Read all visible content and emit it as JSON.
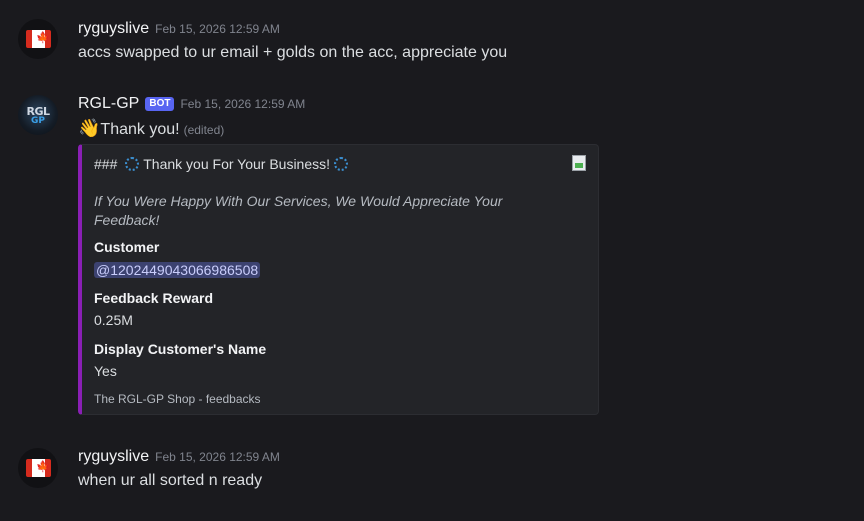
{
  "messages": [
    {
      "author": "ryguyslive",
      "timestamp": "Feb 15, 2026 12:59 AM",
      "text": "accs swapped to ur email + golds on the acc, appreciate you"
    },
    {
      "author": "RGL-GP",
      "bot_tag": "BOT",
      "timestamp": "Feb 15, 2026 12:59 AM",
      "emoji": "👋",
      "text": "Thank you!",
      "edited": "(edited)",
      "embed": {
        "accent_color": "#8a1fb5",
        "title_prefix": "###",
        "title": "Thank you For Your Business!",
        "description": "If You Were Happy With Our Services, We Would Appreciate Your Feedback!",
        "fields": [
          {
            "name": "Customer",
            "value": "@1202449043066986508"
          },
          {
            "name": "Feedback Reward",
            "value": "0.25M"
          },
          {
            "name": "Display Customer's Name",
            "value": "Yes"
          }
        ],
        "footer": "The RGL-GP Shop - feedbacks"
      }
    },
    {
      "author": "ryguyslive",
      "timestamp": "Feb 15, 2026 12:59 AM",
      "text": "when ur all sorted n ready"
    }
  ],
  "avatars": {
    "ryguyslive": "canada-flag-icon",
    "rgl_gp": {
      "line1": "RGL",
      "line2": "GP"
    }
  },
  "flag_leaf": "🍁"
}
